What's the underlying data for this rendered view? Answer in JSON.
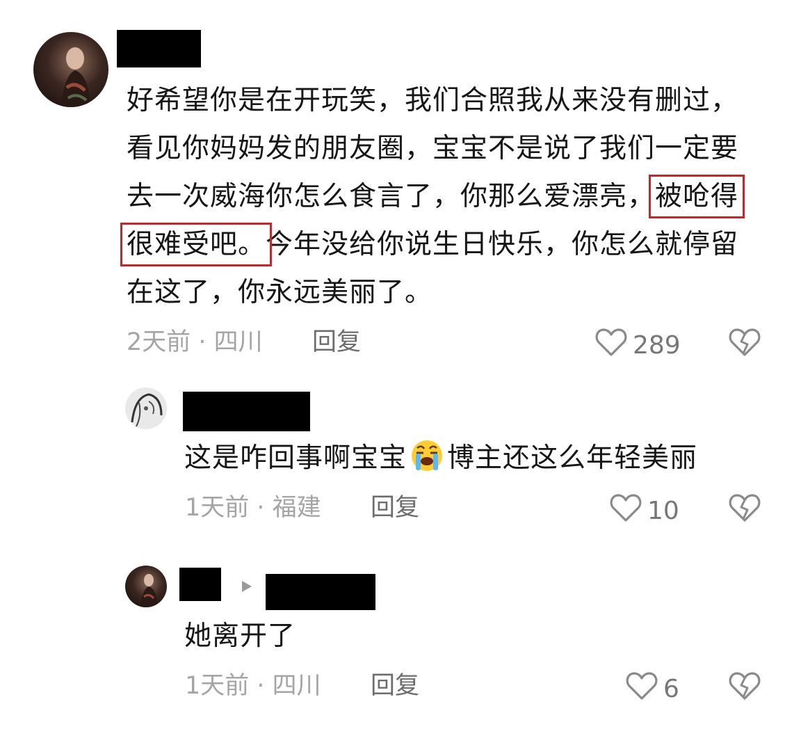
{
  "main_comment": {
    "text_before": "好希望你是在开玩笑，我们合照我从来没有删过，看见你妈妈发的朋友圈，宝宝不是说了我们一定要去一次威海你怎么食言了，你那么爱漂亮，",
    "highlighted": "被呛得很难受吧。",
    "text_after": "今年没给你说生日快乐，你怎么就停留在这了，你永远美丽了。",
    "meta": "2天前 · 四川",
    "reply_label": "回复",
    "likes": "289",
    "highlight_color": "#c1272d"
  },
  "replies": [
    {
      "text_before": "这是咋回事啊宝宝",
      "emoji": "loudly-crying-face",
      "text_after": "博主还这么年轻美丽",
      "meta": "1天前 · 福建",
      "reply_label": "回复",
      "likes": "10"
    },
    {
      "text": "她离开了",
      "meta": "1天前 · 四川",
      "reply_label": "回复",
      "likes": "6"
    }
  ],
  "icons": {
    "like": "heart-outline-icon",
    "dislike": "broken-heart-icon",
    "reply_arrow": "triangle-right-icon"
  }
}
